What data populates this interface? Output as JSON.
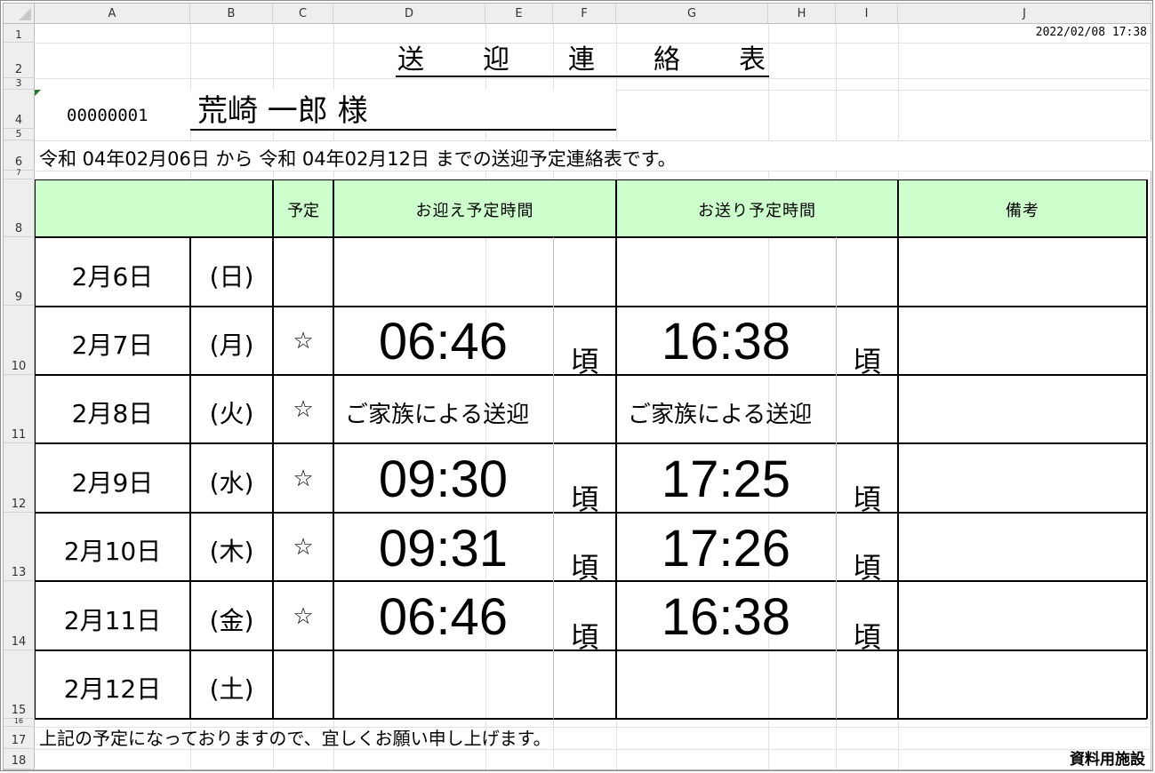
{
  "sheet": {
    "timestamp": "2022/02/08 17:38",
    "title": "送　　迎　　連　　絡　　表",
    "customer_id": "00000001",
    "customer_name": "荒崎 一郎 様",
    "period_text": "令和 04年02月06日 から 令和 04年02月12日 までの送迎予定連絡表です。",
    "table_headers": {
      "date": "",
      "scheduled": "予定",
      "pickup": "お迎え予定時間",
      "dropoff": "お送り予定時間",
      "remarks": "備考"
    },
    "rows": [
      {
        "date": "2月6日",
        "weekday": "(日)",
        "mark": "",
        "pickup": "",
        "pickup_suffix": "",
        "dropoff": "",
        "dropoff_suffix": "",
        "pickup_note": "",
        "dropoff_note": ""
      },
      {
        "date": "2月7日",
        "weekday": "(月)",
        "mark": "☆",
        "pickup": "06:46",
        "pickup_suffix": "頃",
        "dropoff": "16:38",
        "dropoff_suffix": "頃",
        "pickup_note": "",
        "dropoff_note": ""
      },
      {
        "date": "2月8日",
        "weekday": "(火)",
        "mark": "☆",
        "pickup": "",
        "pickup_suffix": "",
        "dropoff": "",
        "dropoff_suffix": "",
        "pickup_note": "ご家族による送迎",
        "dropoff_note": "ご家族による送迎"
      },
      {
        "date": "2月9日",
        "weekday": "(水)",
        "mark": "☆",
        "pickup": "09:30",
        "pickup_suffix": "頃",
        "dropoff": "17:25",
        "dropoff_suffix": "頃",
        "pickup_note": "",
        "dropoff_note": ""
      },
      {
        "date": "2月10日",
        "weekday": "(木)",
        "mark": "☆",
        "pickup": "09:31",
        "pickup_suffix": "頃",
        "dropoff": "17:26",
        "dropoff_suffix": "頃",
        "pickup_note": "",
        "dropoff_note": ""
      },
      {
        "date": "2月11日",
        "weekday": "(金)",
        "mark": "☆",
        "pickup": "06:46",
        "pickup_suffix": "頃",
        "dropoff": "16:38",
        "dropoff_suffix": "頃",
        "pickup_note": "",
        "dropoff_note": ""
      },
      {
        "date": "2月12日",
        "weekday": "(土)",
        "mark": "",
        "pickup": "",
        "pickup_suffix": "",
        "dropoff": "",
        "dropoff_suffix": "",
        "pickup_note": "",
        "dropoff_note": ""
      }
    ],
    "footer_message": "上記の予定になっておりますので、宜しくお願い申し上げます。",
    "facility": "資料用施設"
  },
  "column_headers": [
    "A",
    "B",
    "C",
    "D",
    "E",
    "F",
    "G",
    "H",
    "I",
    "J"
  ],
  "row_headers": [
    "1",
    "2",
    "3",
    "4",
    "5",
    "6",
    "7",
    "8",
    "9",
    "10",
    "11",
    "12",
    "13",
    "14",
    "15",
    "16",
    "17",
    "18"
  ],
  "colors": {
    "header_fill": "#ccffcc",
    "grid_line": "#e1e1e1",
    "header_bar": "#eeeeee",
    "title_underline": "#000000"
  }
}
